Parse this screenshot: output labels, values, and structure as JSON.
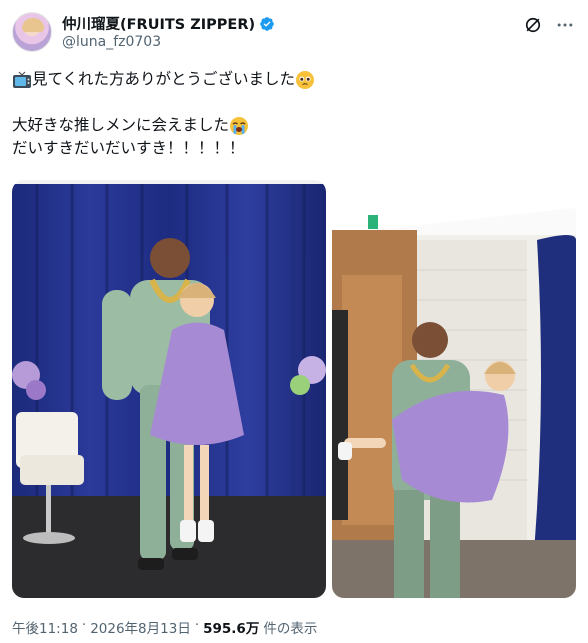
{
  "author": {
    "display_name": "仲川瑠夏(FRUITS ZIPPER)",
    "handle": "@luna_fz0703",
    "verified": true,
    "avatar_icon": "profile-avatar"
  },
  "header_actions": {
    "grok_icon": "grok-icon",
    "more_icon": "more-icon"
  },
  "tweet": {
    "lines": [
      "見てくれた方ありがとうございました",
      "大好きな推しメンに会えました",
      "だいすきだいだいすき！！！！！"
    ],
    "emojis": [
      "tv-emoji",
      "pleading-face-emoji",
      "loudly-crying-face-emoji"
    ]
  },
  "media": [
    {
      "alt": "photo-1"
    },
    {
      "alt": "photo-2"
    }
  ],
  "meta": {
    "time": "午後11:18",
    "separator": "·",
    "date": "2026年8月13日",
    "views_count": "595.6万",
    "views_label": "件の表示"
  },
  "colors": {
    "text": "#0f1419",
    "secondary": "#536471",
    "verified": "#1d9bf0"
  }
}
